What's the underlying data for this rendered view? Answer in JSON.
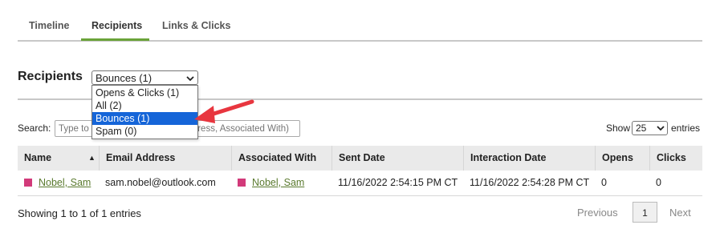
{
  "tabs": [
    {
      "label": "Timeline"
    },
    {
      "label": "Recipients"
    },
    {
      "label": "Links & Clicks"
    }
  ],
  "recipients_title": "Recipients",
  "filter": {
    "selected": "Bounces (1)",
    "options": [
      "Opens & Clicks (1)",
      "All (2)",
      "Bounces (1)",
      "Spam (0)"
    ]
  },
  "search": {
    "label": "Search:",
    "placeholder": "Type to Search (Name, Email Address, Associated With)"
  },
  "entries": {
    "show_label": "Show",
    "value": "25",
    "suffix": "entries"
  },
  "table": {
    "columns": [
      "Name",
      "Email Address",
      "Associated With",
      "Sent Date",
      "Interaction Date",
      "Opens",
      "Clicks"
    ],
    "rows": [
      {
        "name": "Nobel, Sam",
        "email": "sam.nobel@outlook.com",
        "associated_with": "Nobel, Sam",
        "sent_date": "11/16/2022 2:54:15 PM CT",
        "interaction_date": "11/16/2022 2:54:28 PM CT",
        "opens": "0",
        "clicks": "0"
      }
    ]
  },
  "footer": {
    "showing": "Showing 1 to 1 of 1 entries",
    "previous": "Previous",
    "page": "1",
    "next": "Next"
  },
  "colors": {
    "accent": "#6aa339",
    "link": "#5a7a2e",
    "tag": "#d23a7a",
    "selected_option": "#1565d8",
    "annotation_arrow": "#e8363f"
  }
}
